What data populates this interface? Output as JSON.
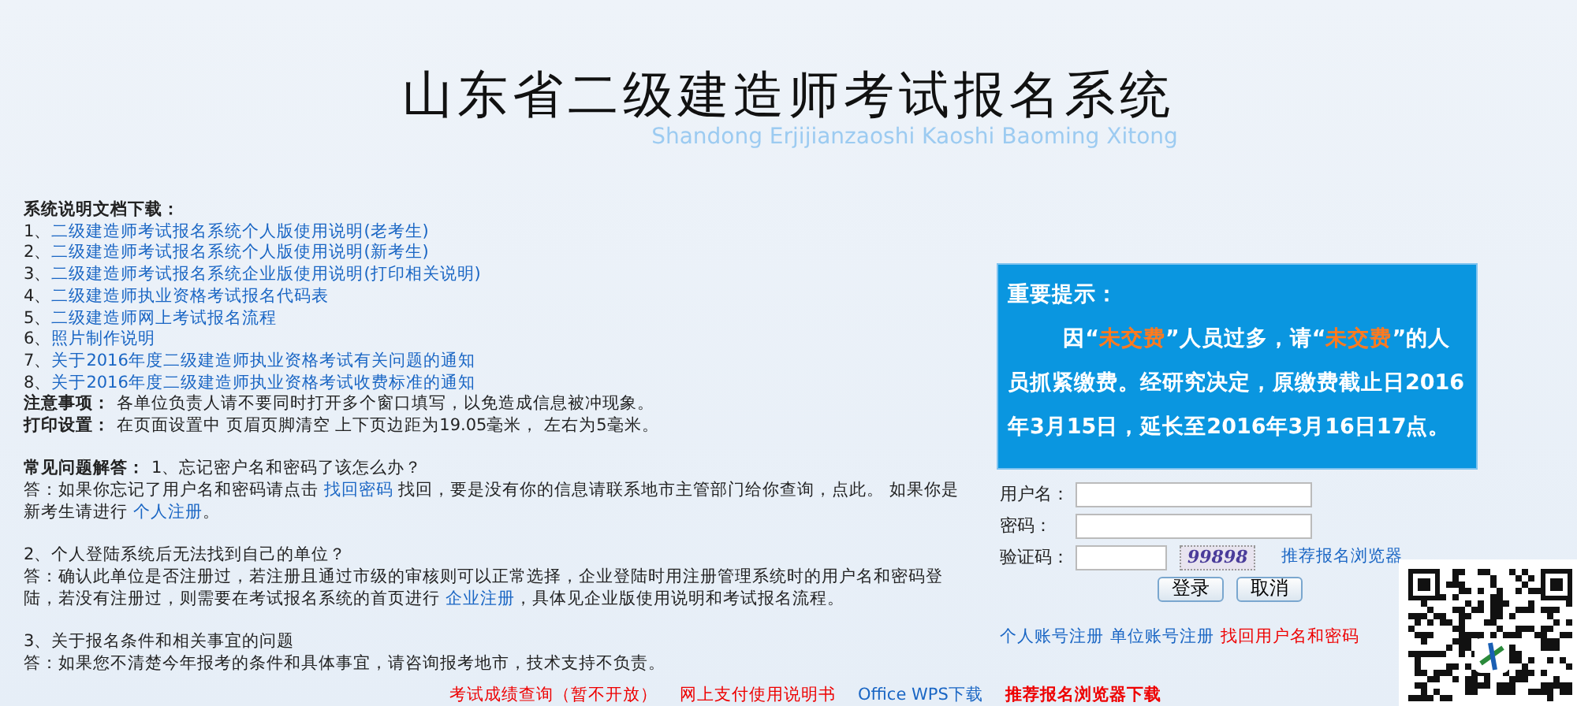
{
  "header": {
    "title": "山东省二级建造师考试报名系统",
    "subtitle": "Shandong Erjijianzaoshi Kaoshi Baoming Xitong"
  },
  "docs": {
    "heading": "系统说明文档下载：",
    "items": [
      {
        "number": "1、",
        "label": "二级建造师考试报名系统个人版使用说明(老考生)"
      },
      {
        "number": "2、",
        "label": "二级建造师考试报名系统个人版使用说明(新考生)"
      },
      {
        "number": "3、",
        "label": "二级建造师考试报名系统企业版使用说明(打印相关说明)"
      },
      {
        "number": "4、",
        "label": "二级建造师执业资格考试报名代码表"
      },
      {
        "number": "5、",
        "label": "二级建造师网上考试报名流程"
      },
      {
        "number": "6、",
        "label": "照片制作说明"
      },
      {
        "number": "7、",
        "label": "关于2016年度二级建造师执业资格考试有关问题的通知"
      },
      {
        "number": "8、",
        "label": "关于2016年度二级建造师执业资格考试收费标准的通知"
      }
    ]
  },
  "notes": [
    {
      "label": "注意事项：",
      "text": "各单位负责人请不要同时打开多个窗口填写，以免造成信息被冲现象。"
    },
    {
      "label": "打印设置：",
      "text": "在页面设置中 页眉页脚清空 上下页边距为19.05毫米， 左右为5毫米。"
    }
  ],
  "faq": {
    "heading": "常见问题解答：",
    "items": [
      {
        "question": "1、忘记密户名和密码了该怎么办？",
        "answer": [
          {
            "kind": "text",
            "text": "答：如果你忘记了用户名和密码请点击 "
          },
          {
            "kind": "link",
            "text": "找回密码"
          },
          {
            "kind": "text",
            "text": " 找回，要是没有你的信息请联系地市主管部门给你查询，点此。 如果你是新考生请进行 "
          },
          {
            "kind": "link",
            "text": "个人注册"
          },
          {
            "kind": "text",
            "text": "。"
          }
        ]
      },
      {
        "question": "2、个人登陆系统后无法找到自己的单位？",
        "answer": [
          {
            "kind": "text",
            "text": "答：确认此单位是否注册过，若注册且通过市级的审核则可以正常选择，企业登陆时用注册管理系统时的用户名和密码登陆，若没有注册过，则需要在考试报名系统的首页进行 "
          },
          {
            "kind": "link",
            "text": "企业注册"
          },
          {
            "kind": "text",
            "text": "，具体见企业版使用说明和考试报名流程。"
          }
        ]
      },
      {
        "question": "3、关于报名条件和相关事宜的问题",
        "answer": [
          {
            "kind": "text",
            "text": "答：如果您不清楚今年报考的条件和具体事宜，请咨询报考地市，技术支持不负责。"
          }
        ]
      }
    ]
  },
  "notice": {
    "title": "重要提示：",
    "parts": [
      {
        "kind": "text",
        "text": "因“"
      },
      {
        "kind": "highlight",
        "text": "未交费"
      },
      {
        "kind": "text",
        "text": "”人员过多，请“"
      },
      {
        "kind": "highlight",
        "text": "未交费"
      },
      {
        "kind": "text",
        "text": "”的人员抓紧缴费。经研究决定，原缴费截止日2016年3月15日，延长至2016年3月16日17点。"
      }
    ]
  },
  "login": {
    "username_label": "用户名：",
    "password_label": "密码：",
    "captcha_label": "验证码：",
    "captcha": "99898",
    "browser_link": "推荐报名浏览器",
    "login_button": "登录",
    "cancel_button": "取消",
    "links": [
      {
        "kind": "link",
        "text": "个人账号注册"
      },
      {
        "kind": "link",
        "text": "单位账号注册"
      },
      {
        "kind": "alert",
        "text": "找回用户名和密码"
      }
    ]
  },
  "footer_links": [
    {
      "kind": "alert",
      "text": "考试成绩查询（暂不开放）"
    },
    {
      "kind": "alert",
      "text": "网上支付使用说明书"
    },
    {
      "kind": "link",
      "text": "Office WPS下载"
    },
    {
      "kind": "strong",
      "text": "推荐报名浏览器下载"
    }
  ]
}
